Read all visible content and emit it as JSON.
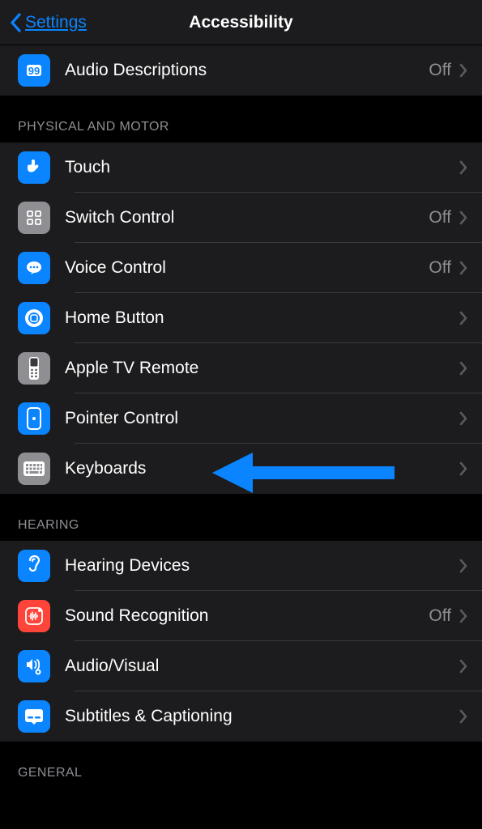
{
  "nav": {
    "back_label": "Settings",
    "title": "Accessibility"
  },
  "rows": {
    "audio_descriptions": {
      "label": "Audio Descriptions",
      "value": "Off"
    },
    "touch": {
      "label": "Touch"
    },
    "switch_control": {
      "label": "Switch Control",
      "value": "Off"
    },
    "voice_control": {
      "label": "Voice Control",
      "value": "Off"
    },
    "home_button": {
      "label": "Home Button"
    },
    "apple_tv_remote": {
      "label": "Apple TV Remote"
    },
    "pointer_control": {
      "label": "Pointer Control"
    },
    "keyboards": {
      "label": "Keyboards"
    },
    "hearing_devices": {
      "label": "Hearing Devices"
    },
    "sound_recognition": {
      "label": "Sound Recognition",
      "value": "Off"
    },
    "audio_visual": {
      "label": "Audio/Visual"
    },
    "subtitles": {
      "label": "Subtitles & Captioning"
    }
  },
  "headers": {
    "physical_motor": "Physical and Motor",
    "hearing": "Hearing",
    "general": "General"
  }
}
